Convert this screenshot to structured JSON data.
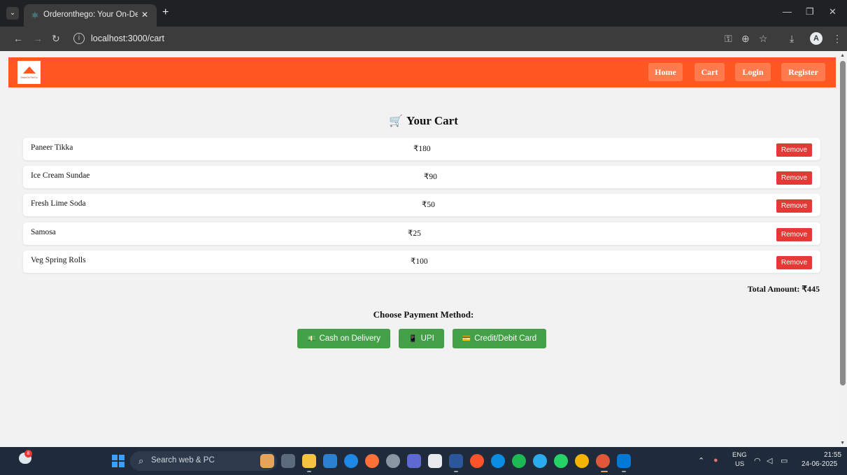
{
  "browser": {
    "tab_title": "Orderonthego: Your On-Demand",
    "tab_close": "✕",
    "new_tab": "+",
    "url": "localhost:3000/cart",
    "controls": {
      "minimize": "—",
      "restore": "❐",
      "close": "✕"
    }
  },
  "navbar": {
    "logo_text": "OrderOnTheGo",
    "links": [
      "Home",
      "Cart",
      "Login",
      "Register"
    ]
  },
  "cart": {
    "title": "Your Cart",
    "items": [
      {
        "name": "Paneer Tikka",
        "price": "₹180"
      },
      {
        "name": "Ice Cream Sundae",
        "price": "₹90"
      },
      {
        "name": "Fresh Lime Soda",
        "price": "₹50"
      },
      {
        "name": "Samosa",
        "price": "₹25"
      },
      {
        "name": "Veg Spring Rolls",
        "price": "₹100"
      }
    ],
    "remove_label": "Remove",
    "total": "Total Amount: ₹445"
  },
  "payment": {
    "heading": "Choose Payment Method:",
    "options": [
      {
        "label": "Cash on Delivery",
        "icon": "cash-icon"
      },
      {
        "label": "UPI",
        "icon": "phone-icon"
      },
      {
        "label": "Credit/Debit Card",
        "icon": "card-icon"
      }
    ]
  },
  "colors": {
    "navbar": "#ff5722",
    "remove": "#e53935",
    "payment": "#43a047"
  },
  "taskbar": {
    "search_placeholder": "Search web & PC",
    "notification_count": "8",
    "lang": "ENG",
    "region": "US",
    "time": "21:55",
    "date": "24-06-2025"
  }
}
